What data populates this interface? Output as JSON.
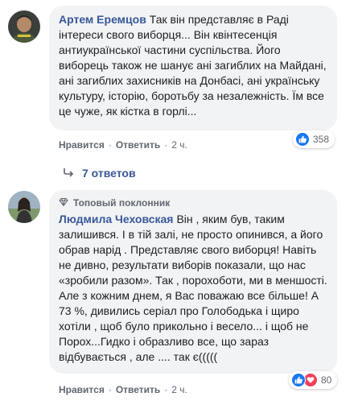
{
  "comments": [
    {
      "author": "Артем Еремцов",
      "text": "Так він представляє в Раді інтереси свого виборця... Він квінтесенція антиукраїнської частини суспільства. Його виборець також не шанує ані загиблих на Майдані, ані загиблих захисників на Донбасі, ані українську культуру, історію, боротьбу за незалежність. Їм все це чуже, як кістка в горлі...",
      "like_label": "Нравится",
      "reply_label": "Ответить",
      "time": "2 ч.",
      "reaction_count": "358",
      "reaction_types": [
        "like-icon"
      ]
    },
    {
      "badge": "Топовый поклонник",
      "badge_icon": "diamond-icon",
      "author": "Людмила Чеховская",
      "text": "Він , яким був, таким залишився. І в тій залі, не просто опинився, а його обрав нарід . Представляє свого виборця! Навіть не дивно, результати виборів показали, що нас «зробили разом». Так , порохоботи, ми в меншості. Але з кожним днем, я Вас поважаю все більше! А 73 %, дивились серіал про Голободька і щиро хотіли , щоб було прикольно і весело... і щоб не Порох...Гидко і образливо все, що зараз відбувається , але .... так є((((( ",
      "like_label": "Нравится",
      "reply_label": "Ответить",
      "time": "2 ч.",
      "reaction_count": "80",
      "reaction_types": [
        "like-icon",
        "heart-icon"
      ]
    }
  ],
  "replies_link": {
    "label": "7 ответов",
    "icon": "reply-arrow-icon"
  },
  "colors": {
    "link": "#385898",
    "bubble": "#f2f3f5",
    "meta": "#606770",
    "like": "#1877f2",
    "heart": "#f33e58"
  }
}
